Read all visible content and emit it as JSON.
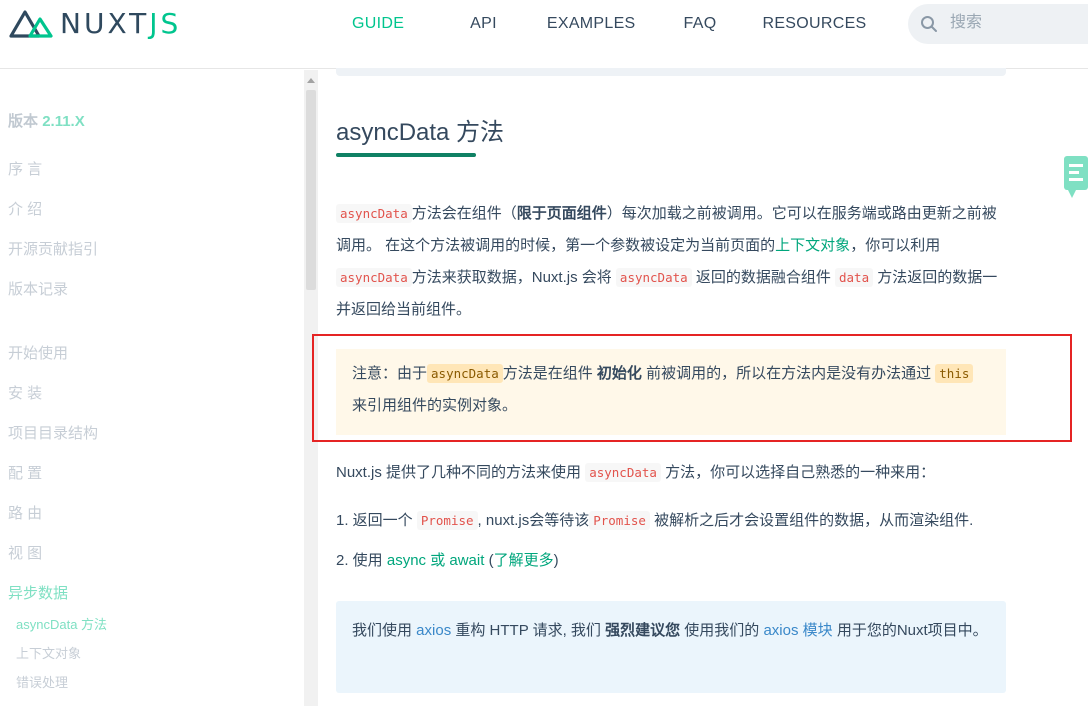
{
  "logo": {
    "text_main": "NUXT",
    "text_accent": "JS"
  },
  "nav": {
    "items": [
      "GUIDE",
      "API",
      "EXAMPLES",
      "FAQ",
      "RESOURCES"
    ],
    "active": "GUIDE"
  },
  "search": {
    "placeholder": "搜索"
  },
  "sidebar": {
    "version_label": "版本",
    "version_value": "2.11.X",
    "group1": [
      "序 言",
      "介 绍",
      "开源贡献指引",
      "版本记录"
    ],
    "group2": [
      "开始使用",
      "安 装",
      "项目目录结构",
      "配 置",
      "路 由",
      "视 图",
      "异步数据"
    ],
    "active_item": "异步数据",
    "subitems": [
      "asyncData 方法",
      "上下文对象",
      "错误处理"
    ],
    "active_subitem": "asyncData 方法"
  },
  "main": {
    "title": "asyncData 方法",
    "para1": {
      "code1": "asyncData",
      "t1": "方法会在组件（",
      "bold1": "限于页面组件",
      "t2": "）每次加载之前被调用。它可以在服务端或路由更新之前被调用。 在这个方法被调用的时候，第一个参数被设定为当前页面的",
      "link1": "上下文对象",
      "t3": "，你可以利用 ",
      "code2": "asyncData",
      "t4": "方法来获取数据，Nuxt.js 会将 ",
      "code3": "asyncData",
      "t5": " 返回的数据融合组件 ",
      "code4": "data",
      "t6": " 方法返回的数据一并返回给当前组件。"
    },
    "warning": {
      "t1": "注意：由于",
      "code1": "asyncData",
      "t2": "方法是在组件 ",
      "bold1": "初始化",
      "t3": " 前被调用的，所以在方法内是没有办法通过 ",
      "code2": "this",
      "t4": " 来引用组件的实例对象。"
    },
    "para2": {
      "t1": "Nuxt.js 提供了几种不同的方法来使用 ",
      "code1": "asyncData",
      "t2": " 方法，你可以选择自己熟悉的一种来用："
    },
    "list": {
      "item1_t1": "1. 返回一个 ",
      "item1_code1": "Promise",
      "item1_t2": ", nuxt.js会等待该",
      "item1_code2": "Promise",
      "item1_t3": " 被解析之后才会设置组件的数据，从而渲染组件.",
      "item2_t1": "2. 使用 ",
      "item2_link1": "async 或 await",
      "item2_t2": " (",
      "item2_link2": "了解更多",
      "item2_t3": ")"
    },
    "info": {
      "t1": "我们使用 ",
      "link1": "axios",
      "t2": " 重构 HTTP 请求, 我们 ",
      "bold1": "强烈建议您",
      "t3": " 使用我们的 ",
      "link2": "axios 模块",
      "t4": " 用于您的Nuxt项目中。"
    }
  },
  "colors": {
    "accent": "#00c58e",
    "logo_dark": "#2f495e",
    "highlight_border": "#e52424",
    "warning_bg": "#fff8e9",
    "info_bg": "#ebf5fc"
  }
}
